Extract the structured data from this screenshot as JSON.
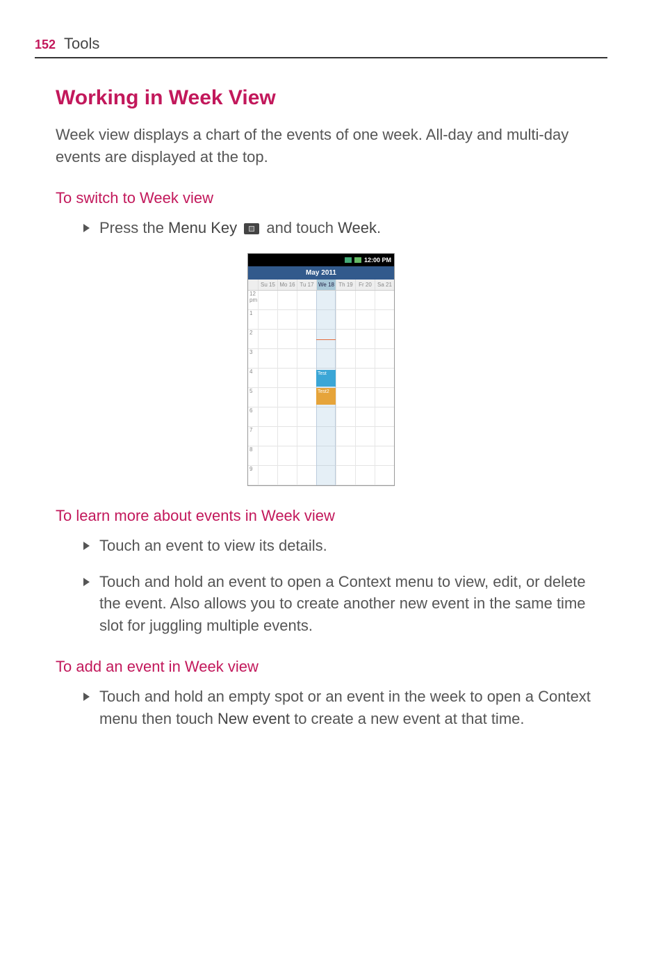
{
  "header": {
    "page_number": "152",
    "section": "Tools"
  },
  "h1": "Working in Week View",
  "intro": "Week view displays a chart of the events of one week. All-day and multi-day events are displayed at the top.",
  "switch": {
    "heading": "To switch to Week view",
    "bullet1_pre": "Press the ",
    "bullet1_bold1": "Menu Key",
    "bullet1_mid": " ",
    "bullet1_mid2": " and touch ",
    "bullet1_bold2": "Week",
    "bullet1_post": "."
  },
  "screenshot": {
    "status_time": "12:00 PM",
    "title": "May 2011",
    "days": [
      "Su 15",
      "Mo 16",
      "Tu 17",
      "We 18",
      "Th 19",
      "Fr 20",
      "Sa 21"
    ],
    "hours": [
      "12\npm",
      "1",
      "2",
      "3",
      "4",
      "5",
      "6",
      "7",
      "8",
      "9"
    ],
    "evt_blue": "Test",
    "evt_orange": "Test2"
  },
  "learn": {
    "heading": "To learn more about events in Week view",
    "b1": "Touch an event to view its details.",
    "b2": "Touch and hold an event to open a Context menu to view, edit, or delete the event. Also allows you to create another new event in the same time slot for juggling multiple events."
  },
  "add": {
    "heading": "To add an event in Week view",
    "b1_pre": "Touch and hold an empty spot or an event in the week to open a Context menu then touch ",
    "b1_bold": "New event",
    "b1_post": " to create a new event at that time."
  }
}
